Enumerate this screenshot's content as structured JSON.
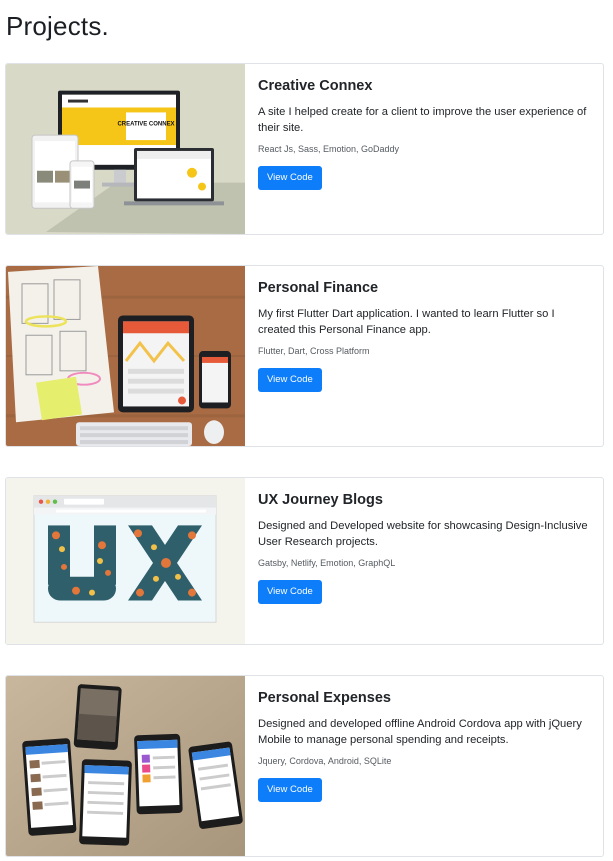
{
  "page": {
    "title": "Projects."
  },
  "projects": [
    {
      "title": "Creative Connex",
      "description": "A site I helped create for a client to improve the user experience of their site.",
      "tags": "React Js, Sass, Emotion, GoDaddy",
      "button_label": "View Code",
      "image_alt": "Responsive devices mockup",
      "image_mark": "CREATIVE CONNEX"
    },
    {
      "title": "Personal Finance",
      "description": "My first Flutter Dart application. I wanted to learn Flutter so I created this Personal Finance app.",
      "tags": "Flutter, Dart, Cross Platform",
      "button_label": "View Code",
      "image_alt": "Tablet and phone on wooden desk"
    },
    {
      "title": "UX Journey Blogs",
      "description": "Designed and Developed website for showcasing Design-Inclusive User Research projects.",
      "tags": "Gatsby, Netlify, Emotion, GraphQL",
      "button_label": "View Code",
      "image_alt": "UX lettering made of icons in a browser window"
    },
    {
      "title": "Personal Expenses",
      "description": "Designed and developed offline Android Cordova app with jQuery Mobile to manage personal spending and receipts.",
      "tags": "Jquery, Cordova, Android, SQLite",
      "button_label": "View Code",
      "image_alt": "Floating Android phone screens"
    }
  ],
  "colors": {
    "button": "#0d7dfa",
    "card_border": "#dfe2e6"
  }
}
